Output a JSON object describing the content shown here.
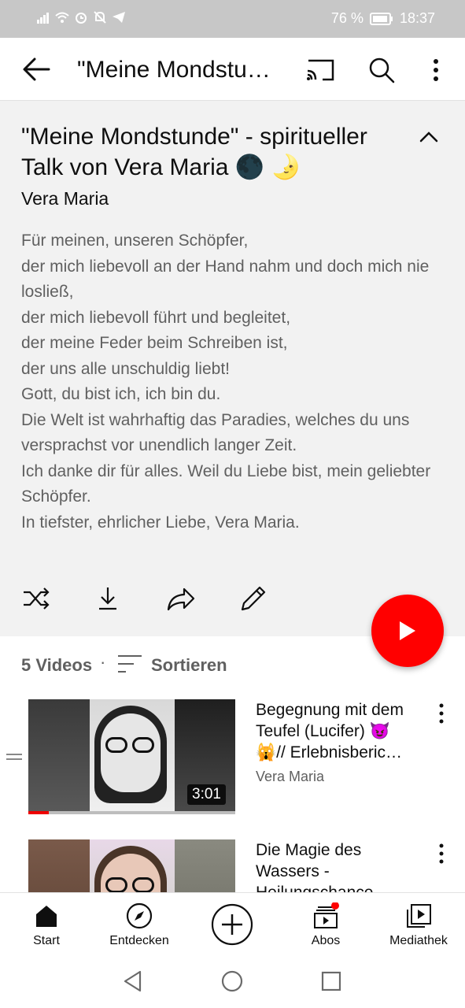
{
  "status": {
    "battery": "76 %",
    "time": "18:37"
  },
  "appbar": {
    "title": "\"Meine Mondstunde\" - spiritueller Talk von Vera Maria"
  },
  "playlist": {
    "title": "\"Meine Mondstunde\" - spiritueller Talk von Vera Maria 🌑 🌛",
    "author": "Vera Maria",
    "description": [
      "Für meinen, unseren Schöpfer,",
      "der mich liebevoll an der Hand nahm und doch mich nie losließ,",
      "der mich liebevoll führt und begleitet,",
      "der meine Feder beim Schreiben ist,",
      "der uns alle unschuldig liebt!",
      "Gott, du bist ich, ich bin du.",
      "Die Welt ist wahrhaftig das Paradies, welches du uns versprachst vor unendlich langer Zeit.",
      "Ich danke dir für alles. Weil du Liebe bist, mein geliebter Schöpfer.",
      "In tiefster, ehrlicher Liebe, Vera Maria."
    ]
  },
  "list": {
    "count": "5 Videos",
    "separator": "·",
    "sort_label": "Sortieren",
    "videos": [
      {
        "title": "Begegnung mit dem Teufel (Lucifer) 😈 🙀// Erlebnisberic…",
        "channel": "Vera Maria",
        "duration": "3:01",
        "watched": 0.1
      },
      {
        "title": "Die Magie des Wassers - Heilungschance…",
        "channel": "",
        "duration": "",
        "watched": 0
      }
    ]
  },
  "nav": {
    "items": [
      {
        "label": "Start"
      },
      {
        "label": "Entdecken"
      },
      {
        "label": "Abos"
      },
      {
        "label": "Mediathek"
      }
    ]
  },
  "colors": {
    "brand": "#ff0000",
    "secondary_text": "#606060"
  }
}
